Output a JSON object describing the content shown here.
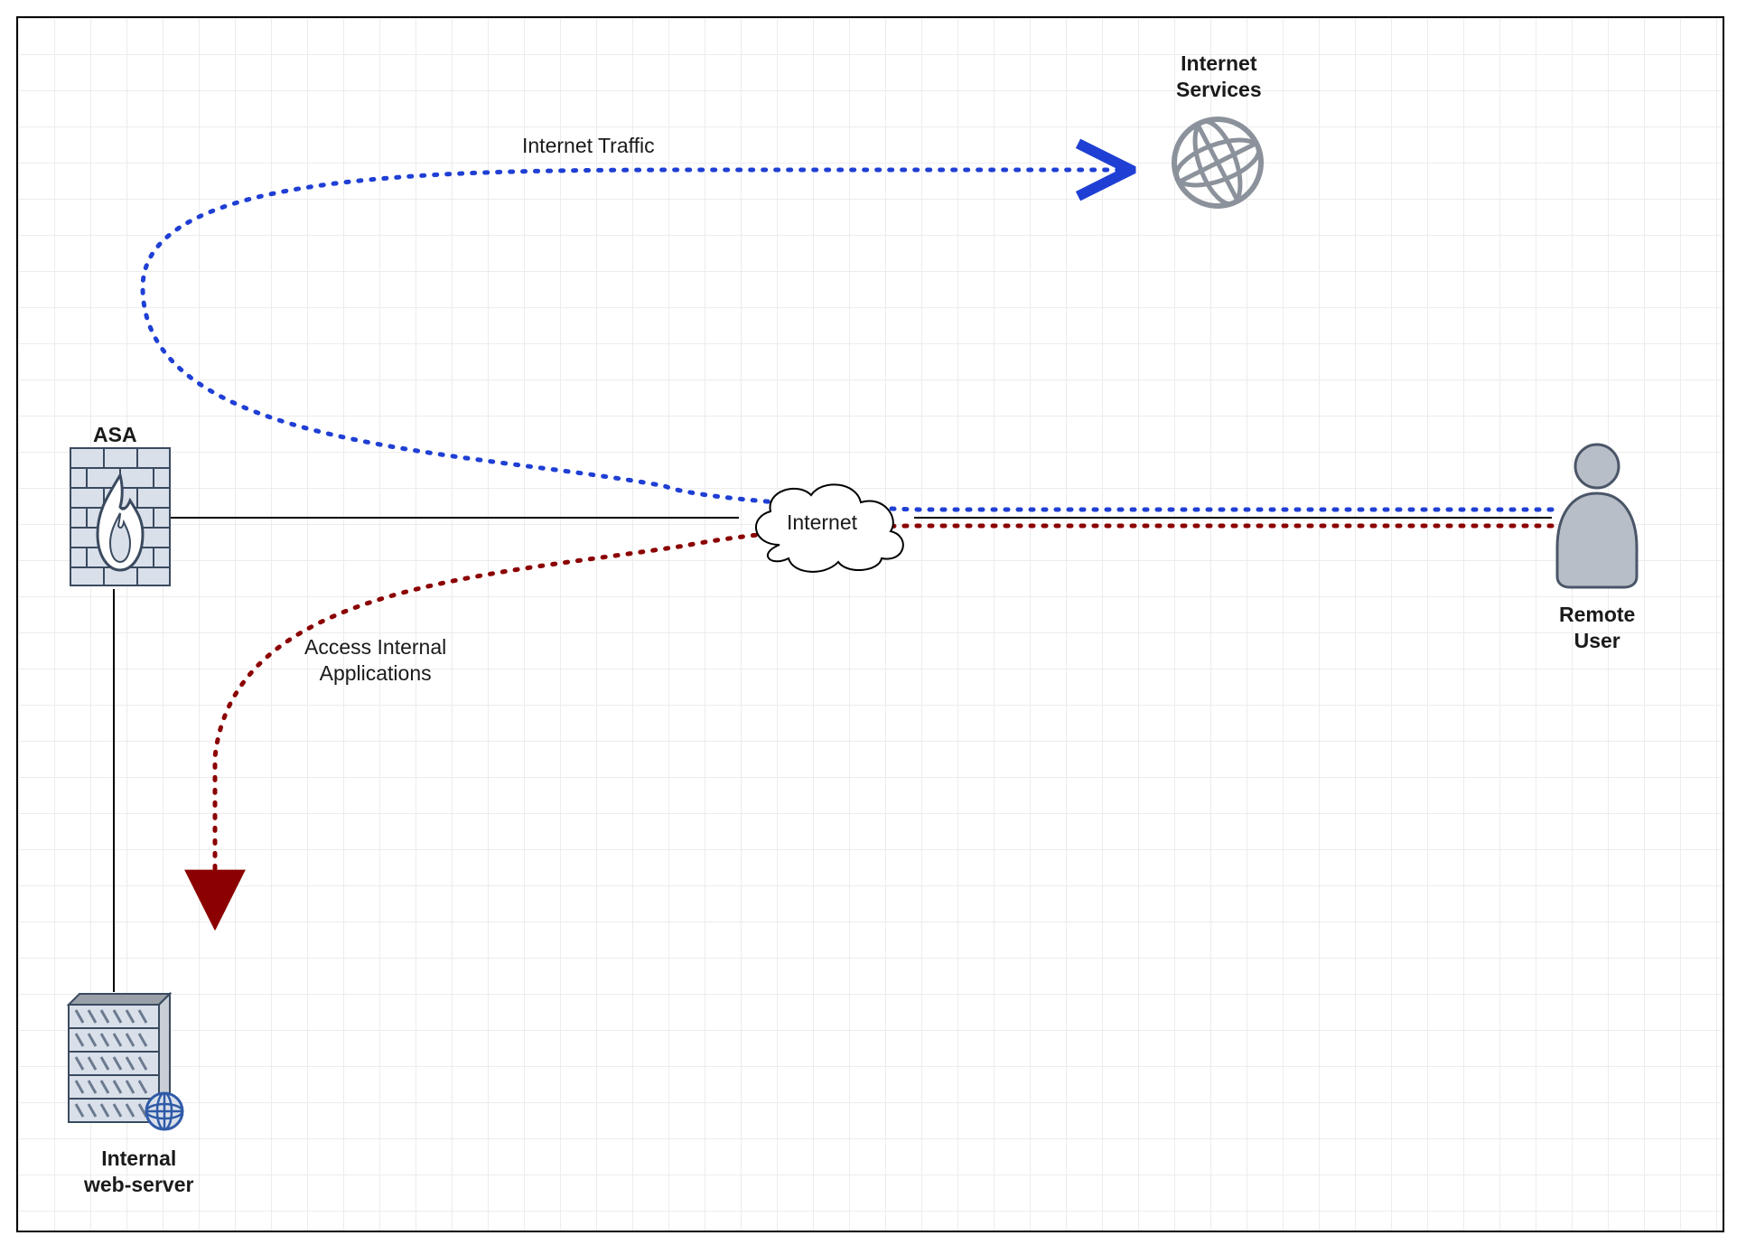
{
  "nodes": {
    "asa": {
      "label": "ASA"
    },
    "internet": {
      "label": "Internet"
    },
    "internet_services": {
      "label": "Internet\nServices"
    },
    "remote_user": {
      "label": "Remote\nUser"
    },
    "web_server": {
      "label": "Internal\nweb-server"
    }
  },
  "edges": {
    "internet_traffic": {
      "label": "Internet Traffic"
    },
    "access_internal": {
      "label": "Access Internal\nApplications"
    }
  },
  "colors": {
    "blue": "#1f3fd4",
    "red": "#8b0000",
    "icon_fill": "#d9e0ea",
    "icon_stroke": "#6b7a8f",
    "grey": "#9aa0a8",
    "user_fill": "#b7bec7",
    "user_stroke": "#4a5668"
  }
}
